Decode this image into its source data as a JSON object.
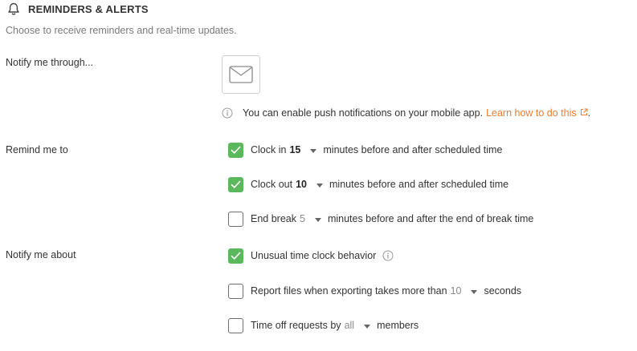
{
  "header": {
    "title": "REMINDERS & ALERTS",
    "icon": "bell-icon"
  },
  "subtitle": "Choose to receive reminders and real-time updates.",
  "labels": {
    "notify_through": "Notify me through...",
    "remind_me_to": "Remind me to",
    "notify_about": "Notify me about"
  },
  "channels": {
    "email_icon": "envelope-icon",
    "email_selected": false
  },
  "push_info": {
    "text": "You can enable push notifications on your mobile app.",
    "link": "Learn how to do this",
    "suffix": "."
  },
  "reminders": [
    {
      "checked": true,
      "prefix": "Clock in",
      "value": "15",
      "suffix": "minutes before and after scheduled time"
    },
    {
      "checked": true,
      "prefix": "Clock out",
      "value": "10",
      "suffix": "minutes before and after scheduled time"
    },
    {
      "checked": false,
      "prefix": "End break",
      "value": "5",
      "suffix": "minutes before and after the end of break time"
    }
  ],
  "notifications": [
    {
      "checked": true,
      "text": "Unusual time clock behavior"
    },
    {
      "checked": false,
      "prefix": "Report files when exporting takes more than",
      "value": "10",
      "suffix": "seconds"
    },
    {
      "checked": false,
      "prefix": "Time off requests by",
      "value": "all",
      "suffix": "members"
    }
  ],
  "colors": {
    "accent": "#ee7c2d",
    "check_green": "#5cb85c"
  }
}
